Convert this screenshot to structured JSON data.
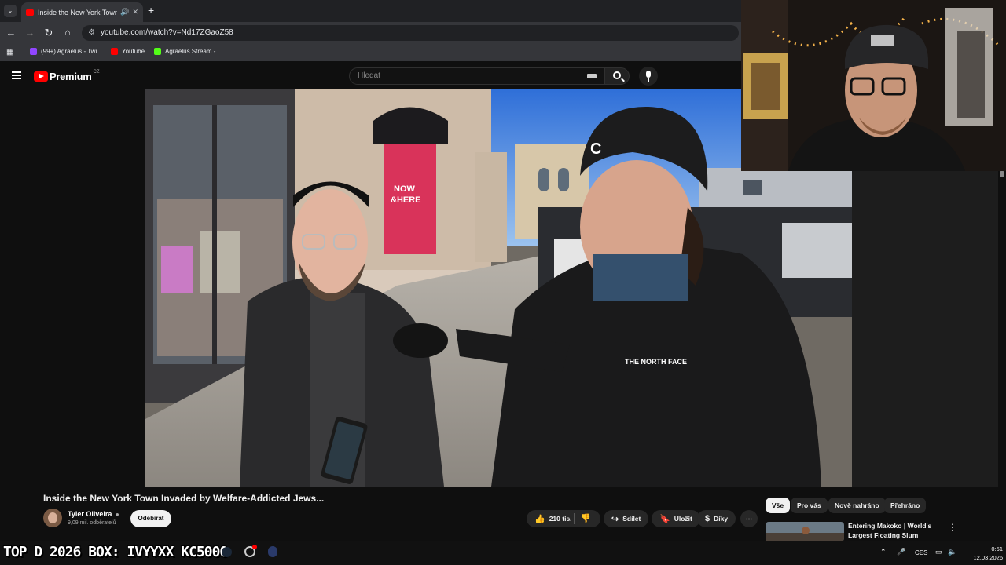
{
  "browser": {
    "tab_title": "Inside the New York Town I",
    "url": "youtube.com/watch?v=Nd17ZGaoZ58",
    "bookmarks": [
      {
        "label": "(99+) Agraelus - Twi...",
        "color": "#9146ff"
      },
      {
        "label": "Youtube",
        "color": "#ff0000"
      },
      {
        "label": "Agraelus Stream -...",
        "color": "#53fc18"
      }
    ]
  },
  "youtube": {
    "logo_text": "Premium",
    "region": "CZ",
    "search_placeholder": "Hledat"
  },
  "video": {
    "title": "Inside the New York Town Invaded by Welfare-Addicted Jews...",
    "channel": "Tyler Oliveira",
    "subscribers": "9,09 mil. odběratelů",
    "subscribe_label": "Odebírat",
    "likes": "210 tis.",
    "share_label": "Sdílet",
    "save_label": "Uložit",
    "thanks_label": "Díky"
  },
  "scene": {
    "sign_line1": "NOW",
    "sign_line2": "&HERE",
    "beanie_letter": "C",
    "jacket_logo": "THE NORTH FACE"
  },
  "sidebar": {
    "chips": [
      "Vše",
      "Pro vás",
      "Nově nahráno",
      "Přehráno"
    ],
    "rec_title": "Entering Makoko | World's Largest Floating Slum"
  },
  "stream_overlay": "TOP D 2026 BOX: IVYYXX KC5000",
  "taskbar": {
    "lang": "CES",
    "time": "0:51",
    "date": "12.03.2026"
  },
  "colors": {
    "youtube_red": "#ff0000",
    "bg": "#0f0f0f",
    "chip_bg": "#272727"
  }
}
